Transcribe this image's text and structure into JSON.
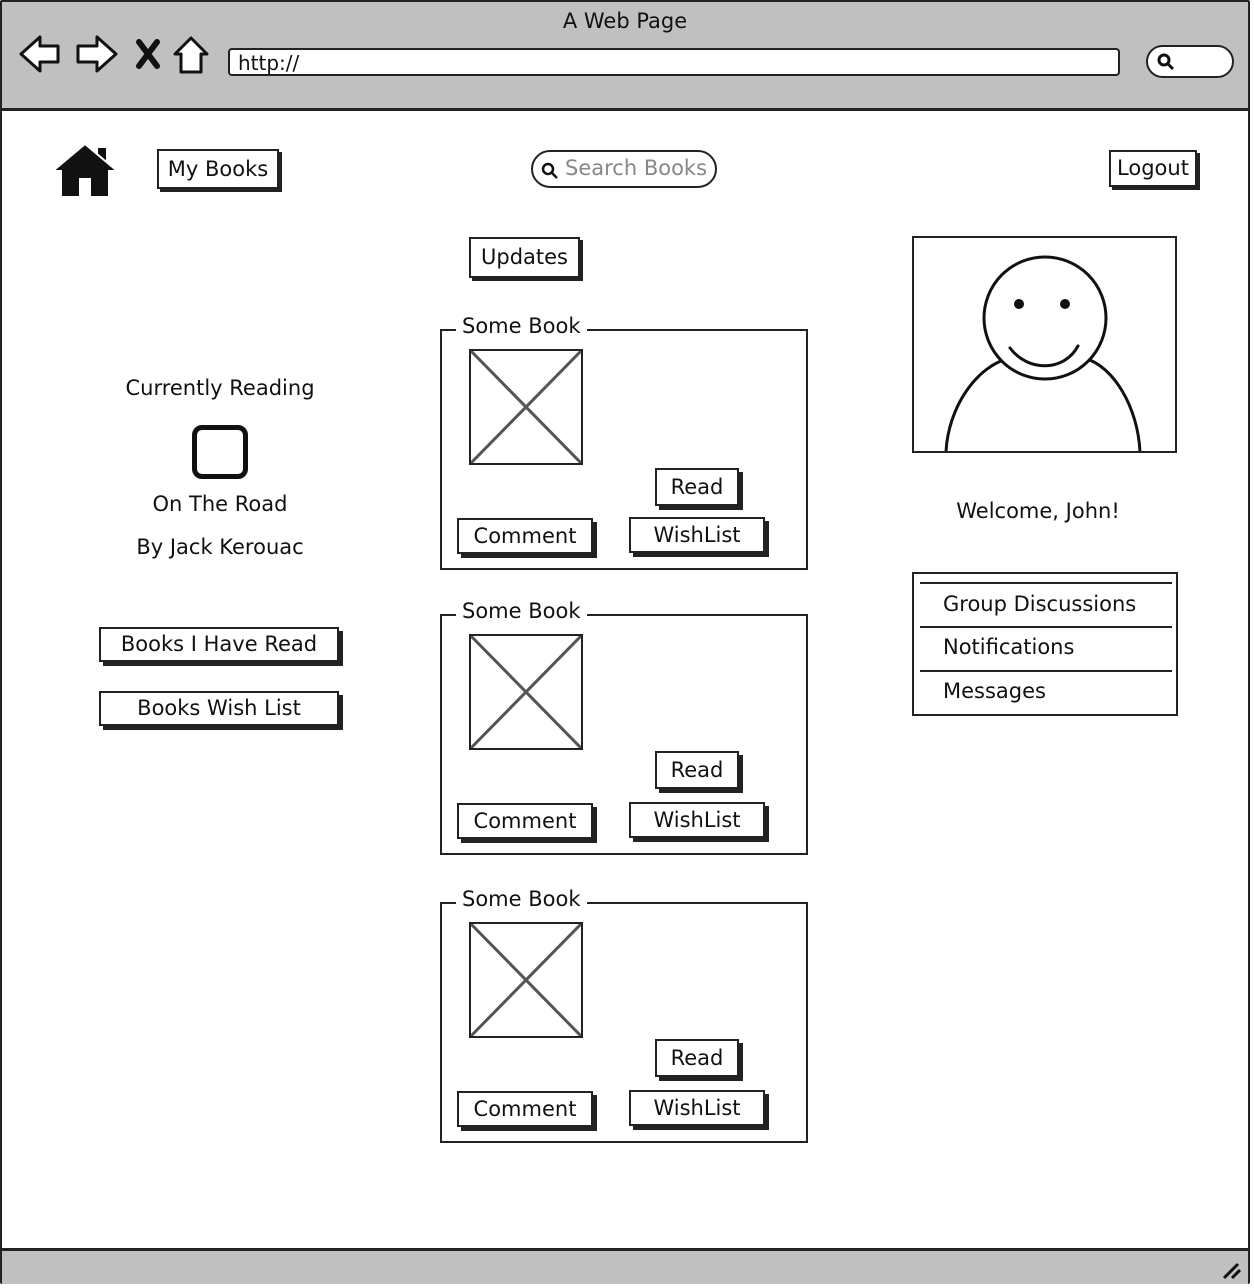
{
  "browser": {
    "title": "A Web Page",
    "url": "http://"
  },
  "header": {
    "my_books": "My Books",
    "search_placeholder": "Search Books",
    "logout": "Logout"
  },
  "left": {
    "currently_reading_label": "Currently Reading",
    "book_title": "On The Road",
    "book_author": "By Jack Kerouac",
    "books_read_button": "Books I Have Read",
    "wish_list_button": "Books Wish List"
  },
  "center": {
    "updates_button": "Updates",
    "books": [
      {
        "title": "Some Book",
        "read": "Read",
        "comment": "Comment",
        "wishlist": "WishList"
      },
      {
        "title": "Some Book",
        "read": "Read",
        "comment": "Comment",
        "wishlist": "WishList"
      },
      {
        "title": "Some Book",
        "read": "Read",
        "comment": "Comment",
        "wishlist": "WishList"
      }
    ]
  },
  "right": {
    "welcome": "Welcome, John!",
    "menu": [
      "Group Discussions",
      "Notifications",
      "Messages"
    ]
  },
  "icons": [
    "back-arrow-icon",
    "forward-arrow-icon",
    "stop-icon",
    "home-icon",
    "search-icon",
    "avatar",
    "image-placeholder",
    "resize-grip-icon"
  ]
}
